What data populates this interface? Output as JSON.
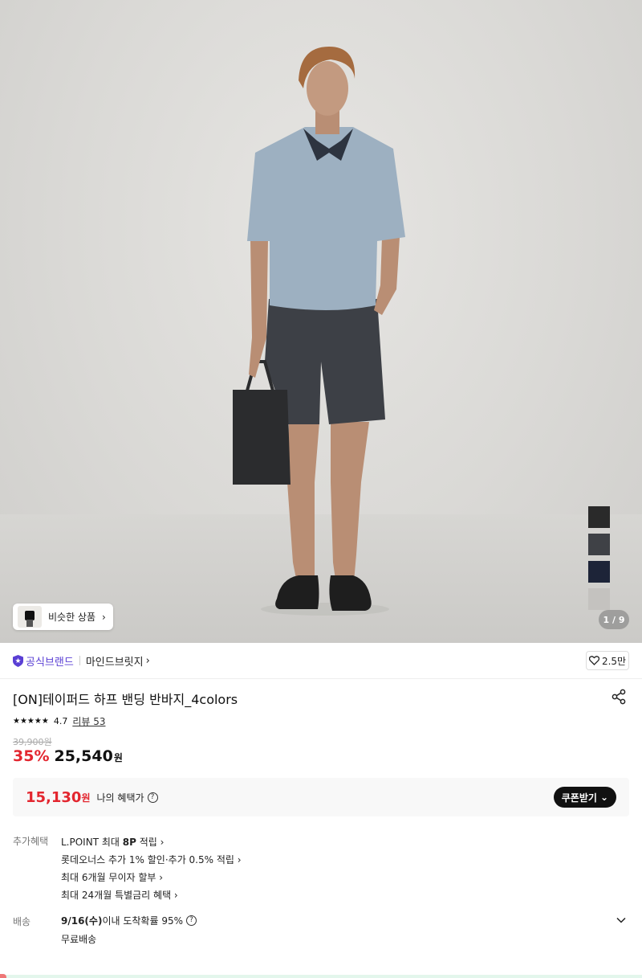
{
  "gallery": {
    "similar_label": "비슷한 상품",
    "similar_chevron": "›",
    "counter": "1 / 9",
    "swatch_colors": [
      "#2a2a2a",
      "#3f4146",
      "#1d2438",
      "#c4c2bf"
    ]
  },
  "brand": {
    "official_label": "공식브랜드",
    "brand_name": "마인드브릿지",
    "brand_chevron": "›",
    "likes": "2.5만"
  },
  "product": {
    "title": "[ON]테이퍼드 하프 밴딩 반바지_4colors",
    "stars": "★★★★★",
    "rating": "4.7",
    "review_label": "리뷰 53",
    "original_price": "39,900원",
    "discount": "35%",
    "price": "25,540",
    "price_unit": "원"
  },
  "benefit": {
    "price": "15,130",
    "price_unit": "원",
    "label": "나의 혜택가",
    "help": "?",
    "coupon_label": "쿠폰받기",
    "coupon_chevron": "⌄"
  },
  "extra": {
    "label": "추가혜택",
    "items": [
      {
        "pre": "L.POINT 최대 ",
        "bold": "8P",
        "post": " 적립 ›"
      },
      {
        "pre": "롯데오너스 추가 1% 할인·추가 0.5% 적립 ›",
        "bold": "",
        "post": ""
      },
      {
        "pre": "최대 6개월 무이자 할부 ›",
        "bold": "",
        "post": ""
      },
      {
        "pre": "최대 24개월 특별금리 혜택 ›",
        "bold": "",
        "post": ""
      }
    ]
  },
  "shipping": {
    "label": "배송",
    "date": "9/16(수)",
    "text": " 이내 도착확률 95%",
    "help": "?",
    "free": "무료배송"
  },
  "colors": {
    "accent_red": "#e3262f",
    "official_purple": "#5a3fd4"
  }
}
